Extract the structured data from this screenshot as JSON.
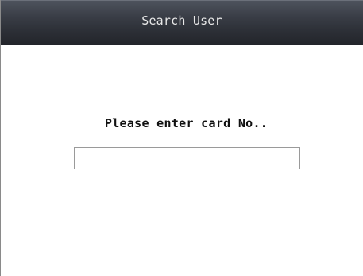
{
  "header": {
    "title": "Search User"
  },
  "main": {
    "prompt": "Please enter card No..",
    "card_input": {
      "value": "",
      "placeholder": ""
    }
  },
  "colors": {
    "header_top": "#4e535d",
    "header_bottom": "#23252b",
    "header_text": "#e8e8e8",
    "background": "#ffffff",
    "input_border": "#9a9a9a"
  }
}
